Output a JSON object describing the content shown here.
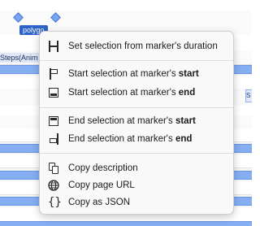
{
  "timeline": {
    "marker_label": "polygo",
    "track_label": "Steps(Anim",
    "side_tag": "S"
  },
  "context_menu": {
    "items": [
      {
        "id": "set-selection-duration",
        "icon": "bracket-icon",
        "prefix": "Set selection from marker's duration",
        "emph": ""
      },
      {
        "id": "start-at-start",
        "icon": "flag-start-icon",
        "prefix": "Start selection at marker's ",
        "emph": "start"
      },
      {
        "id": "start-at-end",
        "icon": "box-end-icon",
        "prefix": "Start selection at marker's ",
        "emph": "end"
      },
      {
        "id": "end-at-start",
        "icon": "box-start-icon",
        "prefix": "End selection at marker's ",
        "emph": "start"
      },
      {
        "id": "end-at-end",
        "icon": "flag-end-icon",
        "prefix": "End selection at marker's ",
        "emph": "end"
      },
      {
        "id": "copy-description",
        "icon": "copy-doc-icon",
        "prefix": "Copy description",
        "emph": ""
      },
      {
        "id": "copy-page-url",
        "icon": "globe-icon",
        "prefix": "Copy page URL",
        "emph": ""
      },
      {
        "id": "copy-json",
        "icon": "braces-icon",
        "prefix": "Copy as JSON",
        "emph": ""
      }
    ]
  },
  "colors": {
    "bar": "#86aef3",
    "marker": "#2d63c8",
    "menu_bg": "#f9f9f9"
  }
}
